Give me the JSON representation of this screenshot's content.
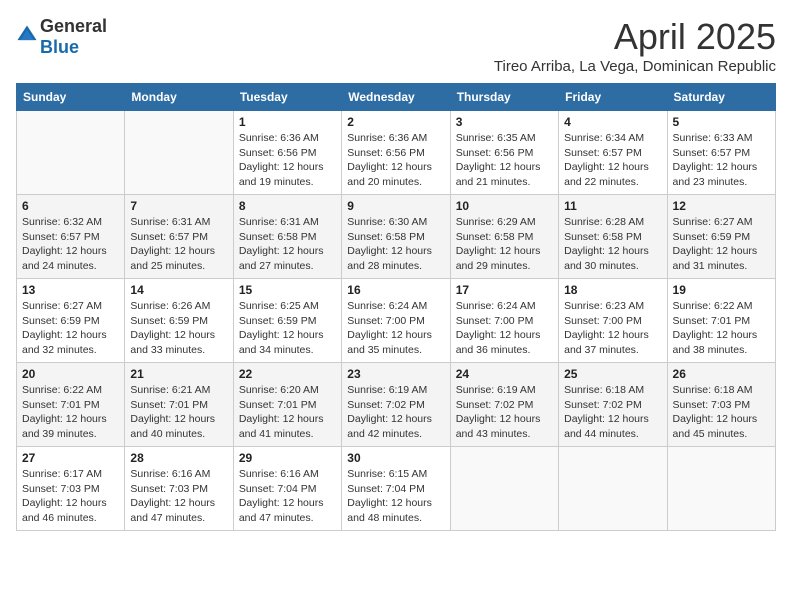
{
  "header": {
    "logo_general": "General",
    "logo_blue": "Blue",
    "month_year": "April 2025",
    "location": "Tireo Arriba, La Vega, Dominican Republic"
  },
  "days_of_week": [
    "Sunday",
    "Monday",
    "Tuesday",
    "Wednesday",
    "Thursday",
    "Friday",
    "Saturday"
  ],
  "weeks": [
    [
      {
        "day": "",
        "info": ""
      },
      {
        "day": "",
        "info": ""
      },
      {
        "day": "1",
        "info": "Sunrise: 6:36 AM\nSunset: 6:56 PM\nDaylight: 12 hours and 19 minutes."
      },
      {
        "day": "2",
        "info": "Sunrise: 6:36 AM\nSunset: 6:56 PM\nDaylight: 12 hours and 20 minutes."
      },
      {
        "day": "3",
        "info": "Sunrise: 6:35 AM\nSunset: 6:56 PM\nDaylight: 12 hours and 21 minutes."
      },
      {
        "day": "4",
        "info": "Sunrise: 6:34 AM\nSunset: 6:57 PM\nDaylight: 12 hours and 22 minutes."
      },
      {
        "day": "5",
        "info": "Sunrise: 6:33 AM\nSunset: 6:57 PM\nDaylight: 12 hours and 23 minutes."
      }
    ],
    [
      {
        "day": "6",
        "info": "Sunrise: 6:32 AM\nSunset: 6:57 PM\nDaylight: 12 hours and 24 minutes."
      },
      {
        "day": "7",
        "info": "Sunrise: 6:31 AM\nSunset: 6:57 PM\nDaylight: 12 hours and 25 minutes."
      },
      {
        "day": "8",
        "info": "Sunrise: 6:31 AM\nSunset: 6:58 PM\nDaylight: 12 hours and 27 minutes."
      },
      {
        "day": "9",
        "info": "Sunrise: 6:30 AM\nSunset: 6:58 PM\nDaylight: 12 hours and 28 minutes."
      },
      {
        "day": "10",
        "info": "Sunrise: 6:29 AM\nSunset: 6:58 PM\nDaylight: 12 hours and 29 minutes."
      },
      {
        "day": "11",
        "info": "Sunrise: 6:28 AM\nSunset: 6:58 PM\nDaylight: 12 hours and 30 minutes."
      },
      {
        "day": "12",
        "info": "Sunrise: 6:27 AM\nSunset: 6:59 PM\nDaylight: 12 hours and 31 minutes."
      }
    ],
    [
      {
        "day": "13",
        "info": "Sunrise: 6:27 AM\nSunset: 6:59 PM\nDaylight: 12 hours and 32 minutes."
      },
      {
        "day": "14",
        "info": "Sunrise: 6:26 AM\nSunset: 6:59 PM\nDaylight: 12 hours and 33 minutes."
      },
      {
        "day": "15",
        "info": "Sunrise: 6:25 AM\nSunset: 6:59 PM\nDaylight: 12 hours and 34 minutes."
      },
      {
        "day": "16",
        "info": "Sunrise: 6:24 AM\nSunset: 7:00 PM\nDaylight: 12 hours and 35 minutes."
      },
      {
        "day": "17",
        "info": "Sunrise: 6:24 AM\nSunset: 7:00 PM\nDaylight: 12 hours and 36 minutes."
      },
      {
        "day": "18",
        "info": "Sunrise: 6:23 AM\nSunset: 7:00 PM\nDaylight: 12 hours and 37 minutes."
      },
      {
        "day": "19",
        "info": "Sunrise: 6:22 AM\nSunset: 7:01 PM\nDaylight: 12 hours and 38 minutes."
      }
    ],
    [
      {
        "day": "20",
        "info": "Sunrise: 6:22 AM\nSunset: 7:01 PM\nDaylight: 12 hours and 39 minutes."
      },
      {
        "day": "21",
        "info": "Sunrise: 6:21 AM\nSunset: 7:01 PM\nDaylight: 12 hours and 40 minutes."
      },
      {
        "day": "22",
        "info": "Sunrise: 6:20 AM\nSunset: 7:01 PM\nDaylight: 12 hours and 41 minutes."
      },
      {
        "day": "23",
        "info": "Sunrise: 6:19 AM\nSunset: 7:02 PM\nDaylight: 12 hours and 42 minutes."
      },
      {
        "day": "24",
        "info": "Sunrise: 6:19 AM\nSunset: 7:02 PM\nDaylight: 12 hours and 43 minutes."
      },
      {
        "day": "25",
        "info": "Sunrise: 6:18 AM\nSunset: 7:02 PM\nDaylight: 12 hours and 44 minutes."
      },
      {
        "day": "26",
        "info": "Sunrise: 6:18 AM\nSunset: 7:03 PM\nDaylight: 12 hours and 45 minutes."
      }
    ],
    [
      {
        "day": "27",
        "info": "Sunrise: 6:17 AM\nSunset: 7:03 PM\nDaylight: 12 hours and 46 minutes."
      },
      {
        "day": "28",
        "info": "Sunrise: 6:16 AM\nSunset: 7:03 PM\nDaylight: 12 hours and 47 minutes."
      },
      {
        "day": "29",
        "info": "Sunrise: 6:16 AM\nSunset: 7:04 PM\nDaylight: 12 hours and 47 minutes."
      },
      {
        "day": "30",
        "info": "Sunrise: 6:15 AM\nSunset: 7:04 PM\nDaylight: 12 hours and 48 minutes."
      },
      {
        "day": "",
        "info": ""
      },
      {
        "day": "",
        "info": ""
      },
      {
        "day": "",
        "info": ""
      }
    ]
  ]
}
